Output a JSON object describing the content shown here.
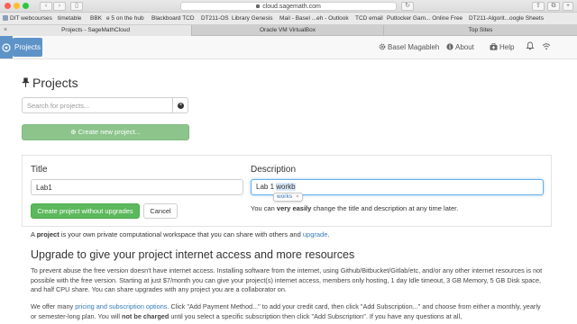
{
  "browser": {
    "url": "cloud.sagemath.com",
    "favorites": [
      "DIT webcourses",
      "timetable",
      "BBK",
      "e 5 on the hub",
      "Blackboard TCD",
      "DT211-OS",
      "Library Genesis",
      "Mail - Basel ...eh - Outlook",
      "TCD email",
      "Putlocker Gam... Online Free",
      "DT211-Algorit...oogle Sheets"
    ],
    "tabs": [
      {
        "label": "Projects - SageMathCloud",
        "active": true
      },
      {
        "label": "Oracle VM VirtualBox",
        "active": false
      },
      {
        "label": "Top Sites",
        "active": false
      }
    ]
  },
  "nav": {
    "projects_tab": "Projects",
    "user_name": "Basel Magableh",
    "about": "About",
    "help": "Help"
  },
  "page": {
    "title": "Projects",
    "search_placeholder": "Search for projects...",
    "create_new_label": "Create new project..."
  },
  "form": {
    "title_label": "Title",
    "title_value": "Lab1",
    "description_label": "Description",
    "description_typed": "Lab 1 ",
    "description_marked": "workb",
    "autocorrect_suggestion": "works",
    "autocorrect_close": "×",
    "create_button": "Create project without upgrades",
    "cancel_button": "Cancel",
    "help_pre": "You can ",
    "help_bold": "very easily",
    "help_post": " change the title and description at any time later."
  },
  "info": {
    "def_pre": "A ",
    "def_bold": "project",
    "def_mid": " is your own private computational workspace that you can share with others and ",
    "def_link": "upgrade",
    "def_end": ".",
    "upgrade_heading": "Upgrade to give your project internet access and more resources",
    "para1": "To prevent abuse the free version doesn't have internet access. Installing software from the internet, using Github/Bitbucket/Gitlab/etc, and/or any other internet resources is not possible with the free version. Starting at just $7/month you can give your project(s) internet access, members only hosting, 1 day Idle timeout, 3 GB Memory, 5 GB Disk space, and half CPU share. You can share upgrades with any project you are a collaborator on.",
    "para2_pre": "We offer many ",
    "para2_link": "pricing and subscription options",
    "para2_mid": ". Click \"Add Payment Method...\" to add your credit card, then click \"Add Subscription...\" and choose from either a monthly, yearly or semester-long plan. You will ",
    "para2_bold": "not be charged",
    "para2_end": " until you select a specific subscription then click \"Add Subscription\". If you have any questions at all,"
  },
  "colors": {
    "brand_blue": "#5e93c7",
    "success_green": "#5cb85c",
    "link_blue": "#337ab7"
  }
}
